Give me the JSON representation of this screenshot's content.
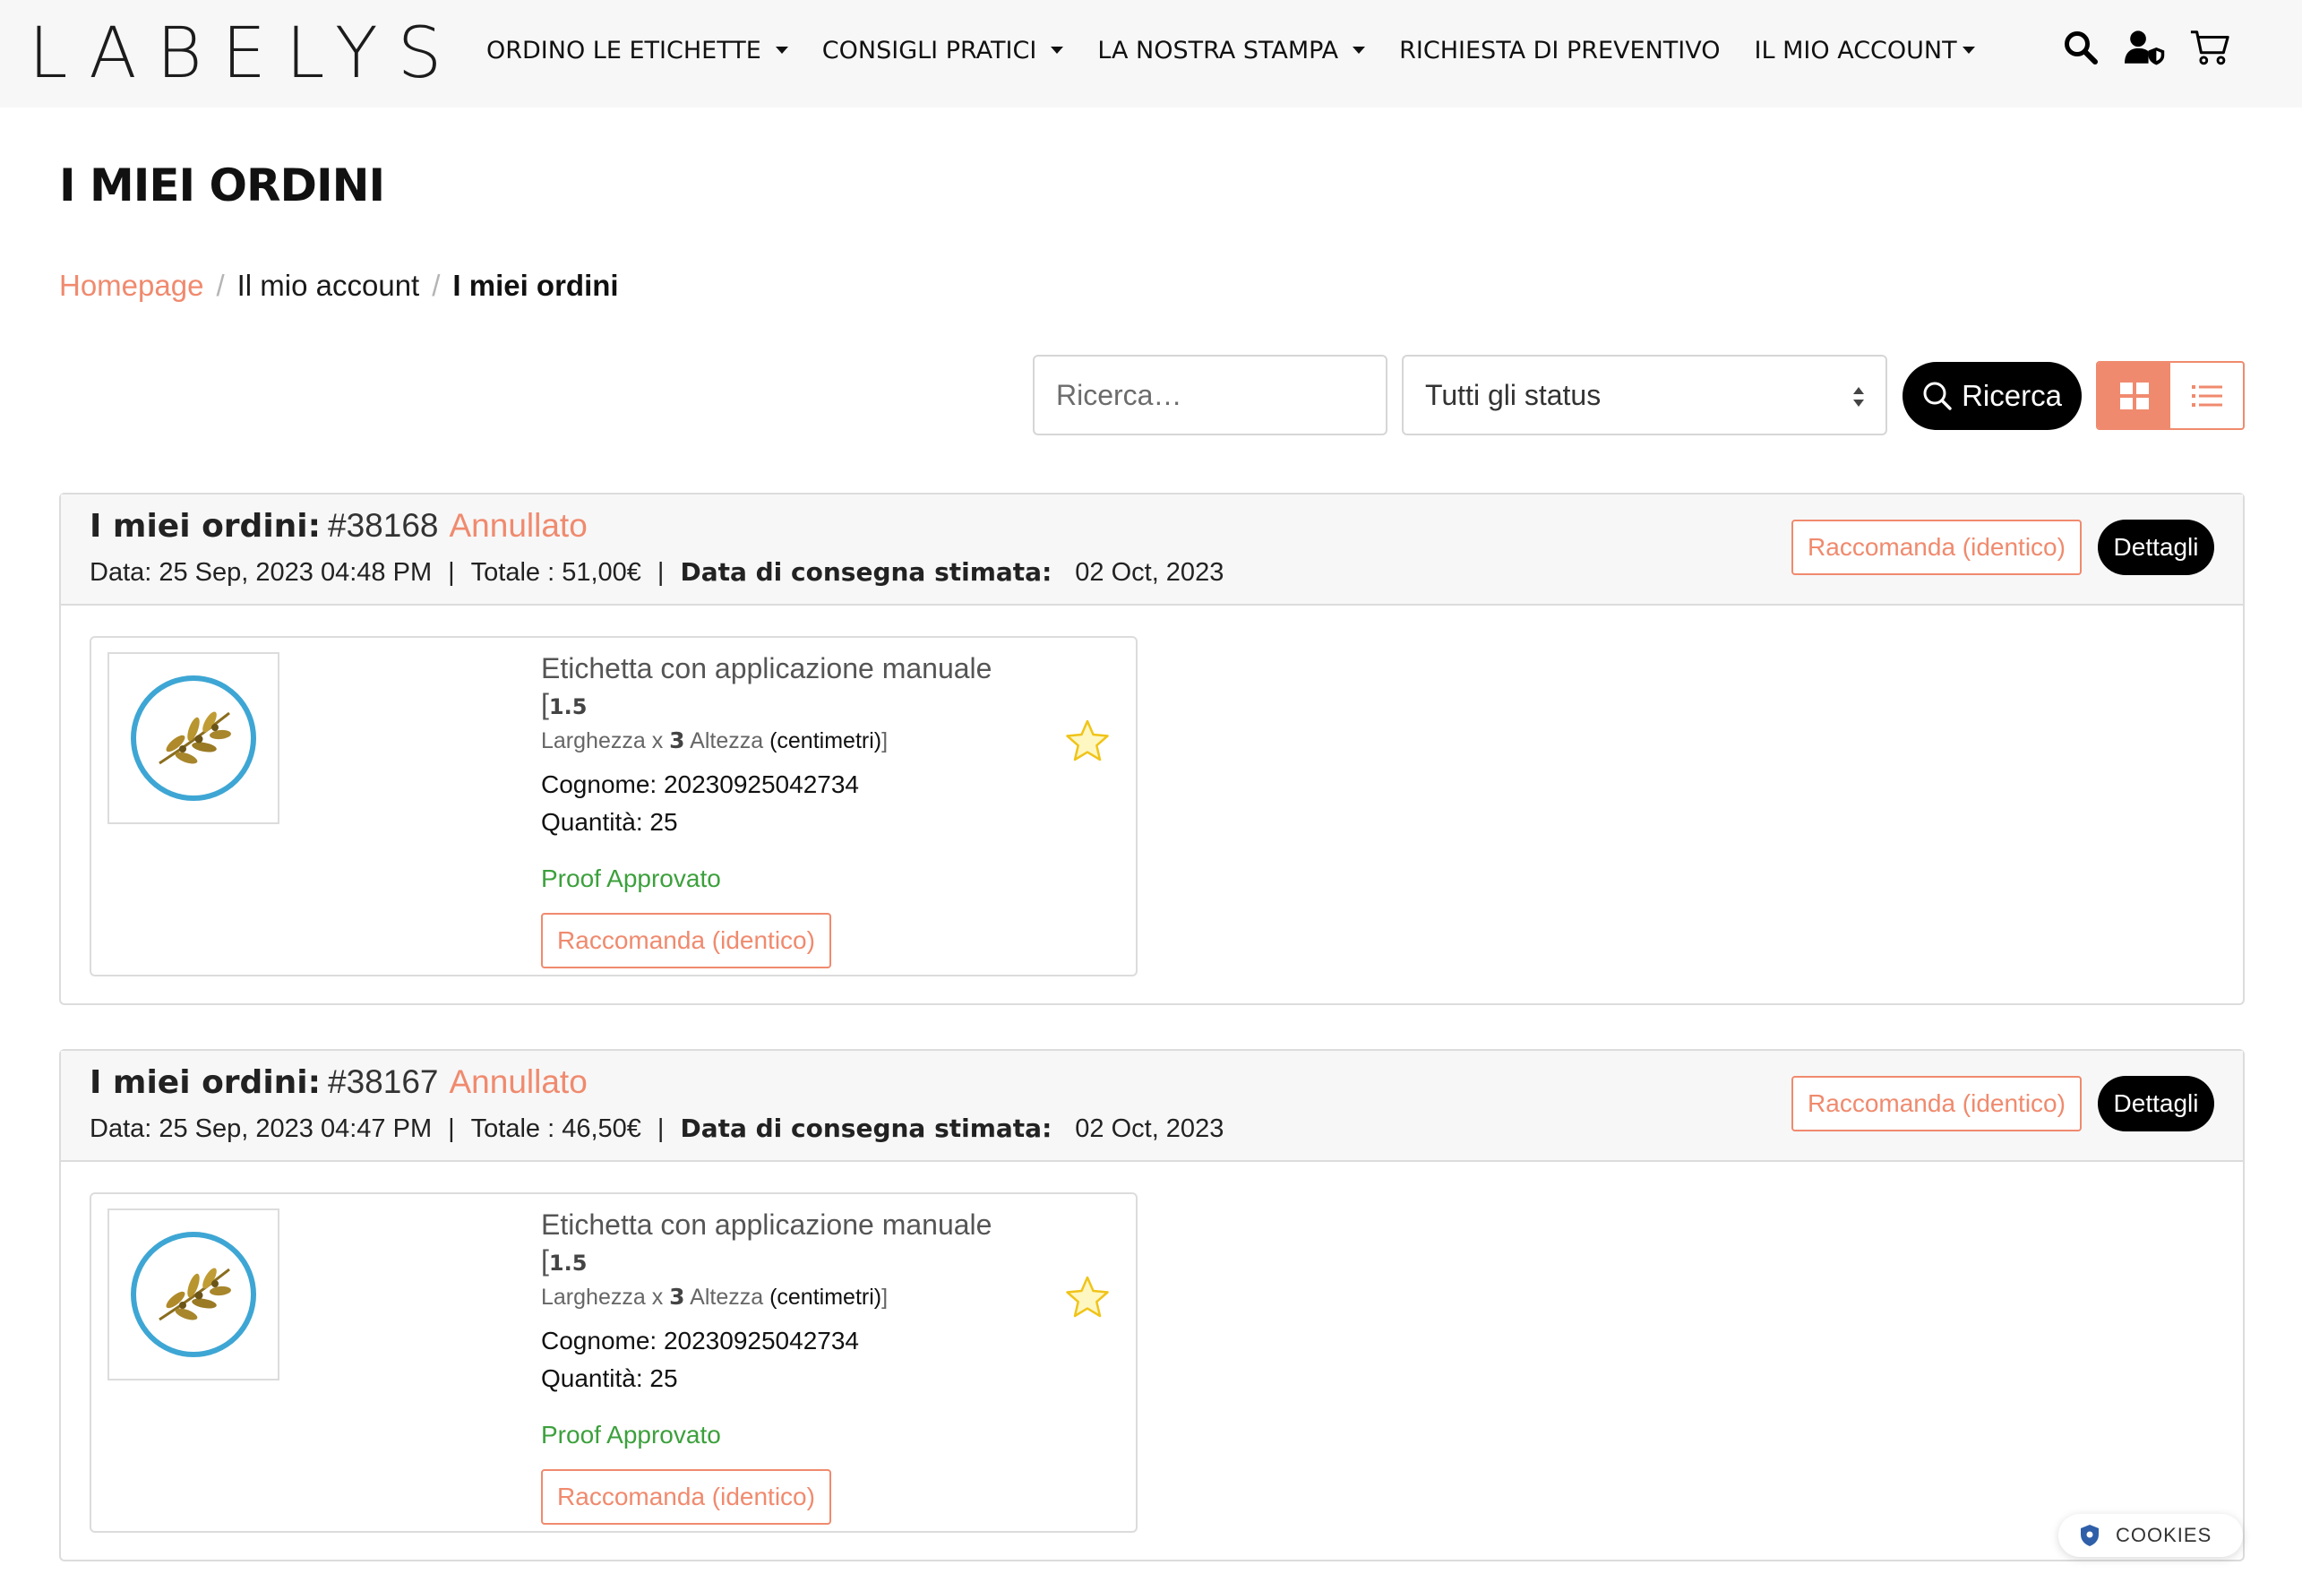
{
  "brand": {
    "logo_text": "LABELYS"
  },
  "nav": {
    "items": [
      {
        "label": "ORDINO LE ETICHETTE",
        "dropdown": true
      },
      {
        "label": "CONSIGLI PRATICI",
        "dropdown": true
      },
      {
        "label": "LA NOSTRA STAMPA",
        "dropdown": true
      },
      {
        "label": "RICHIESTA DI PREVENTIVO",
        "dropdown": false
      },
      {
        "label": "IL MIO ACCOUNT",
        "dropdown": true
      }
    ],
    "icons": [
      "search-icon",
      "user-shield-icon",
      "cart-icon"
    ]
  },
  "page": {
    "title": "I MIEI ORDINI"
  },
  "breadcrumb": {
    "home": "Homepage",
    "account": "Il mio account",
    "current": "I miei ordini"
  },
  "filters": {
    "search_placeholder": "Ricerca…",
    "status_selected": "Tutti gli status",
    "search_button": "Ricerca",
    "view_mode": "grid"
  },
  "orders": [
    {
      "label": "I miei ordini:",
      "number": "#38168",
      "status": "Annullato",
      "date_text": "Data: 25 Sep, 2023 04:48 PM",
      "total_text": "Totale : 51,00€",
      "delivery_label": "Data di consegna stimata:",
      "delivery_date": "02 Oct, 2023",
      "recommend_label": "Raccomanda (identico)",
      "details_label": "Dettagli",
      "item": {
        "title": "Etichetta con applicazione manuale",
        "width": "1.5",
        "width_label": "Larghezza x",
        "height": "3",
        "height_label": "Altezza",
        "unit": "(centimetri)",
        "surname": "Cognome: 20230925042734",
        "quantity": "Quantità: 25",
        "proof_status": "Proof Approvato",
        "recommend_label": "Raccomanda (identico)"
      }
    },
    {
      "label": "I miei ordini:",
      "number": "#38167",
      "status": "Annullato",
      "date_text": "Data: 25 Sep, 2023 04:47 PM",
      "total_text": "Totale : 46,50€",
      "delivery_label": "Data di consegna stimata:",
      "delivery_date": "02 Oct, 2023",
      "recommend_label": "Raccomanda (identico)",
      "details_label": "Dettagli",
      "item": {
        "title": "Etichetta con applicazione manuale",
        "width": "1.5",
        "width_label": "Larghezza x",
        "height": "3",
        "height_label": "Altezza",
        "unit": "(centimetri)",
        "surname": "Cognome: 20230925042734",
        "quantity": "Quantità: 25",
        "proof_status": "Proof Approvato",
        "recommend_label": "Raccomanda (identico)"
      }
    }
  ],
  "cookies": {
    "label": "COOKIES"
  },
  "colors": {
    "accent": "#f08a6e",
    "proof_green": "#3ca03c",
    "dark": "#000000",
    "header_bg": "#f7f7f7"
  }
}
